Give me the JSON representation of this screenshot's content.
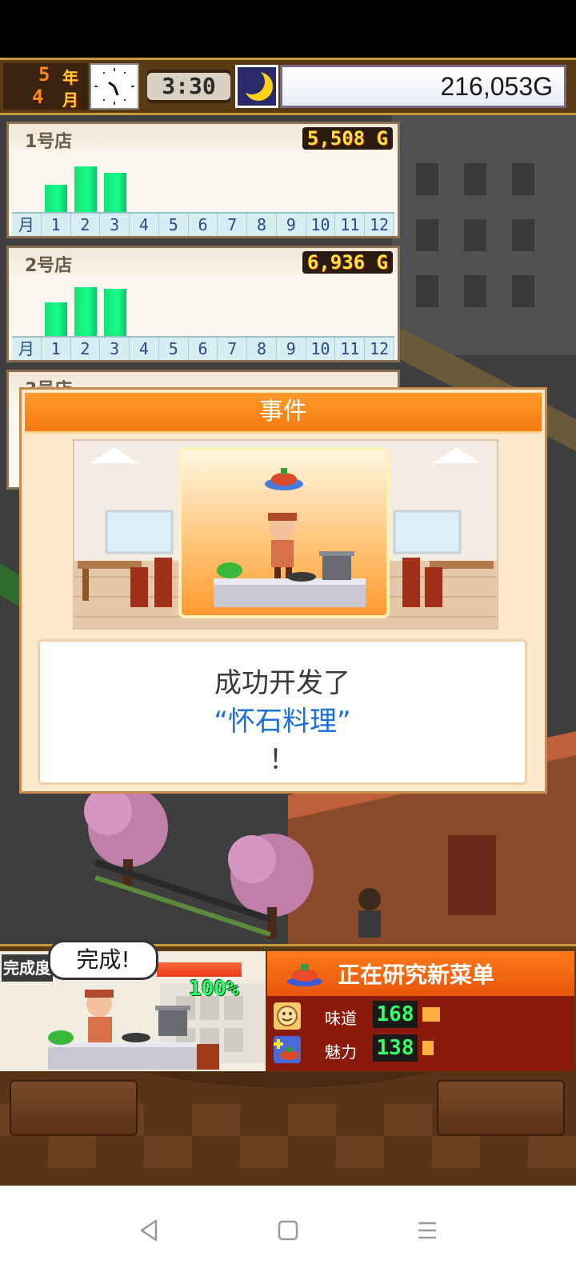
{
  "status": {
    "year_num": "5",
    "year_unit": "年",
    "month_num": "4",
    "month_unit": "月",
    "time": "3:30",
    "money": "216,053G"
  },
  "stores": [
    {
      "name": "1号店",
      "money": "5,508 G",
      "bars": [
        0.54,
        0.89,
        0.77,
        0,
        0,
        0,
        0,
        0,
        0,
        0,
        0,
        0
      ]
    },
    {
      "name": "2号店",
      "money": "6,936 G",
      "bars": [
        0.66,
        0.96,
        0.93,
        0,
        0,
        0,
        0,
        0,
        0,
        0,
        0,
        0
      ]
    },
    {
      "name": "3号店",
      "money": ""
    }
  ],
  "months": [
    "月",
    "1",
    "2",
    "3",
    "4",
    "5",
    "6",
    "7",
    "8",
    "9",
    "10",
    "11",
    "12"
  ],
  "event": {
    "title": "事件",
    "line1": "成功开发了",
    "line2": "“怀石料理”",
    "line3": "！"
  },
  "research": {
    "done_tag": "完成度",
    "bubble": "完成!",
    "progress_label": "100%",
    "progress": 1.0,
    "title": "正在研究新菜单",
    "stats": [
      {
        "label": "味道",
        "value": "168",
        "icon": "taste-icon"
      },
      {
        "label": "魅力",
        "value": "138",
        "icon": "charm-icon"
      }
    ]
  },
  "colors": {
    "accent_orange": "#f57a10",
    "money_yellow": "#ffe23a",
    "bar_green": "#16ff86",
    "dish_blue": "#1a6fd8"
  },
  "navbar": {
    "back": "back-icon",
    "home": "home-icon",
    "menu": "menu-icon"
  }
}
